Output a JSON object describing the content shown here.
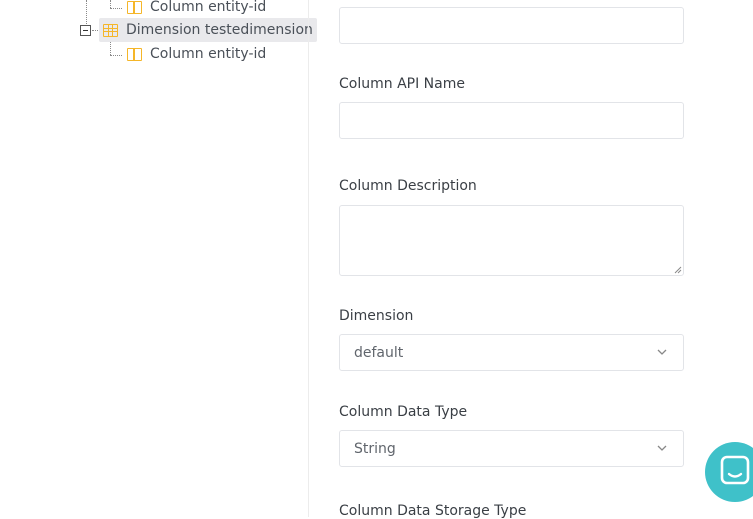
{
  "tree": {
    "nodes": [
      {
        "label": "Column entity-id",
        "type": "column"
      },
      {
        "label": "Dimension testedimension",
        "type": "table",
        "selected": true
      },
      {
        "label": "Column entity-id",
        "type": "column"
      }
    ]
  },
  "form": {
    "column_api_name_label": "Column API Name",
    "column_description_label": "Column Description",
    "dimension_label": "Dimension",
    "dimension_value": "default",
    "column_data_type_label": "Column Data Type",
    "column_data_type_value": "String",
    "column_data_storage_type_label": "Column Data Storage Type"
  },
  "colors": {
    "accent_icon": "#f5b629",
    "chat_button": "#3fc1c9",
    "selected_node_bg": "#e9e9ec"
  },
  "icons": {
    "column": "column-icon",
    "table": "table-icon",
    "chat": "chat-icon",
    "chevron": "chevron-down-icon"
  }
}
